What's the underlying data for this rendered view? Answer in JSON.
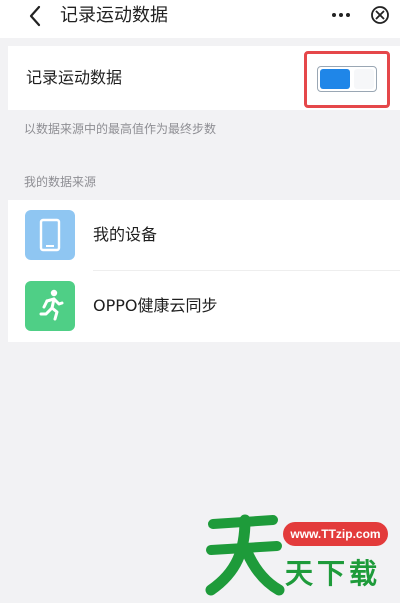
{
  "header": {
    "back_icon": "chevron-left-icon",
    "title": "记录运动数据",
    "more_icon": "more-dots-icon",
    "close_icon": "close-circle-icon"
  },
  "record_toggle": {
    "label": "记录运动数据",
    "enabled": true,
    "accent_color": "#1f86e8",
    "highlight_color": "#e5474a"
  },
  "description": "以数据来源中的最高值作为最终步数",
  "sources": {
    "section_label": "我的数据来源",
    "items": [
      {
        "label": "我的设备",
        "icon": "phone-icon",
        "icon_color": "#8fc6f2"
      },
      {
        "label": "OPPO健康云同步",
        "icon": "running-icon",
        "icon_color": "#4fcf86"
      }
    ]
  },
  "watermark": {
    "url": "www.TTzip.com",
    "text": "天下载",
    "brand_color": "#1e9b3a"
  }
}
